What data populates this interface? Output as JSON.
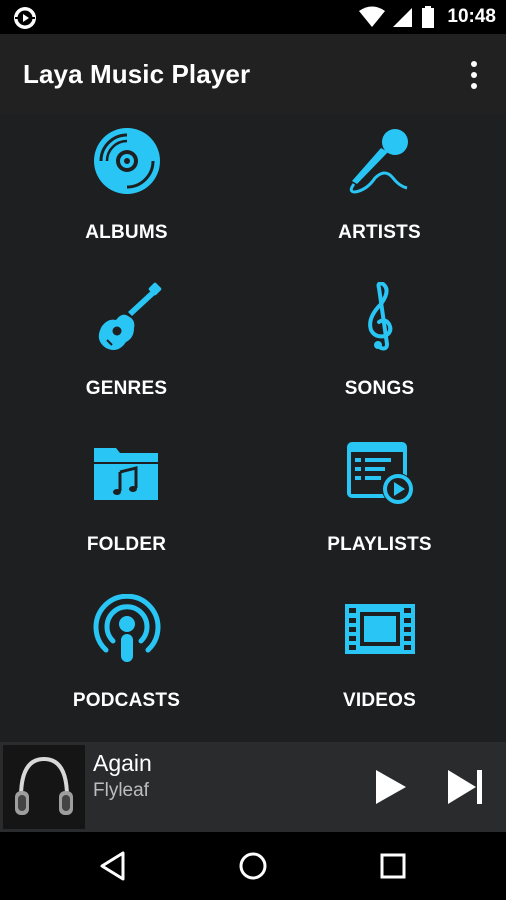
{
  "status_bar": {
    "time": "10:48"
  },
  "app_bar": {
    "title": "Laya Music Player"
  },
  "menu": [
    {
      "label": "ALBUMS",
      "icon": "disc-icon"
    },
    {
      "label": "ARTISTS",
      "icon": "microphone-icon"
    },
    {
      "label": "GENRES",
      "icon": "guitar-icon"
    },
    {
      "label": "SONGS",
      "icon": "treble-clef-icon"
    },
    {
      "label": "FOLDER",
      "icon": "music-folder-icon"
    },
    {
      "label": "PLAYLISTS",
      "icon": "playlist-icon"
    },
    {
      "label": "PODCASTS",
      "icon": "podcast-icon"
    },
    {
      "label": "VIDEOS",
      "icon": "film-icon"
    }
  ],
  "now_playing": {
    "title": "Again",
    "artist": "Flyleaf"
  },
  "colors": {
    "accent": "#29c6f5",
    "background": "#1e1f21",
    "app_bar": "#212121",
    "now_playing_bar": "#2a2b2d"
  }
}
